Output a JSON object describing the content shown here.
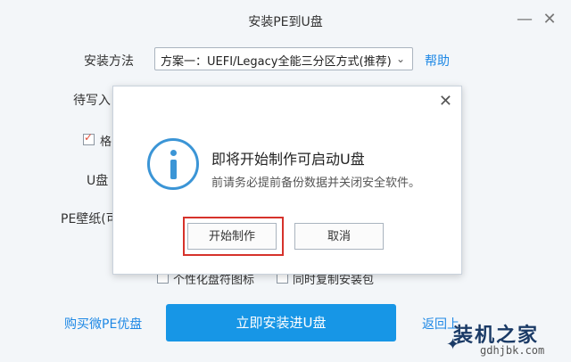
{
  "window": {
    "title": "安装PE到U盘",
    "minimize_icon": "minimize-icon",
    "close_icon": "close-icon"
  },
  "form": {
    "method_label": "安装方法",
    "method_value": "方案一：UEFI/Legacy全能三分区方式(推荐)",
    "help_link": "帮助",
    "target_label_partial": "待写入",
    "format_checkbox_partial": "格",
    "format_checked": true,
    "usb_label_partial": "U盘",
    "wallpaper_label_partial": "PE壁纸(可",
    "opt1_partial": "个性化盘符图标",
    "opt2_partial": "同时复制安装包"
  },
  "footer": {
    "buy_link": "购买微PE优盘",
    "install_button": "立即安装进U盘",
    "back_link_partial": "返回上"
  },
  "dialog": {
    "heading": "即将开始制作可启动U盘",
    "subtext": "前请务必提前备份数据并关闭安全软件。",
    "start_button": "开始制作",
    "cancel_button": "取消",
    "icon": "info-icon"
  },
  "watermark": {
    "title": "装机之家",
    "url": "gdhjbk.com"
  }
}
